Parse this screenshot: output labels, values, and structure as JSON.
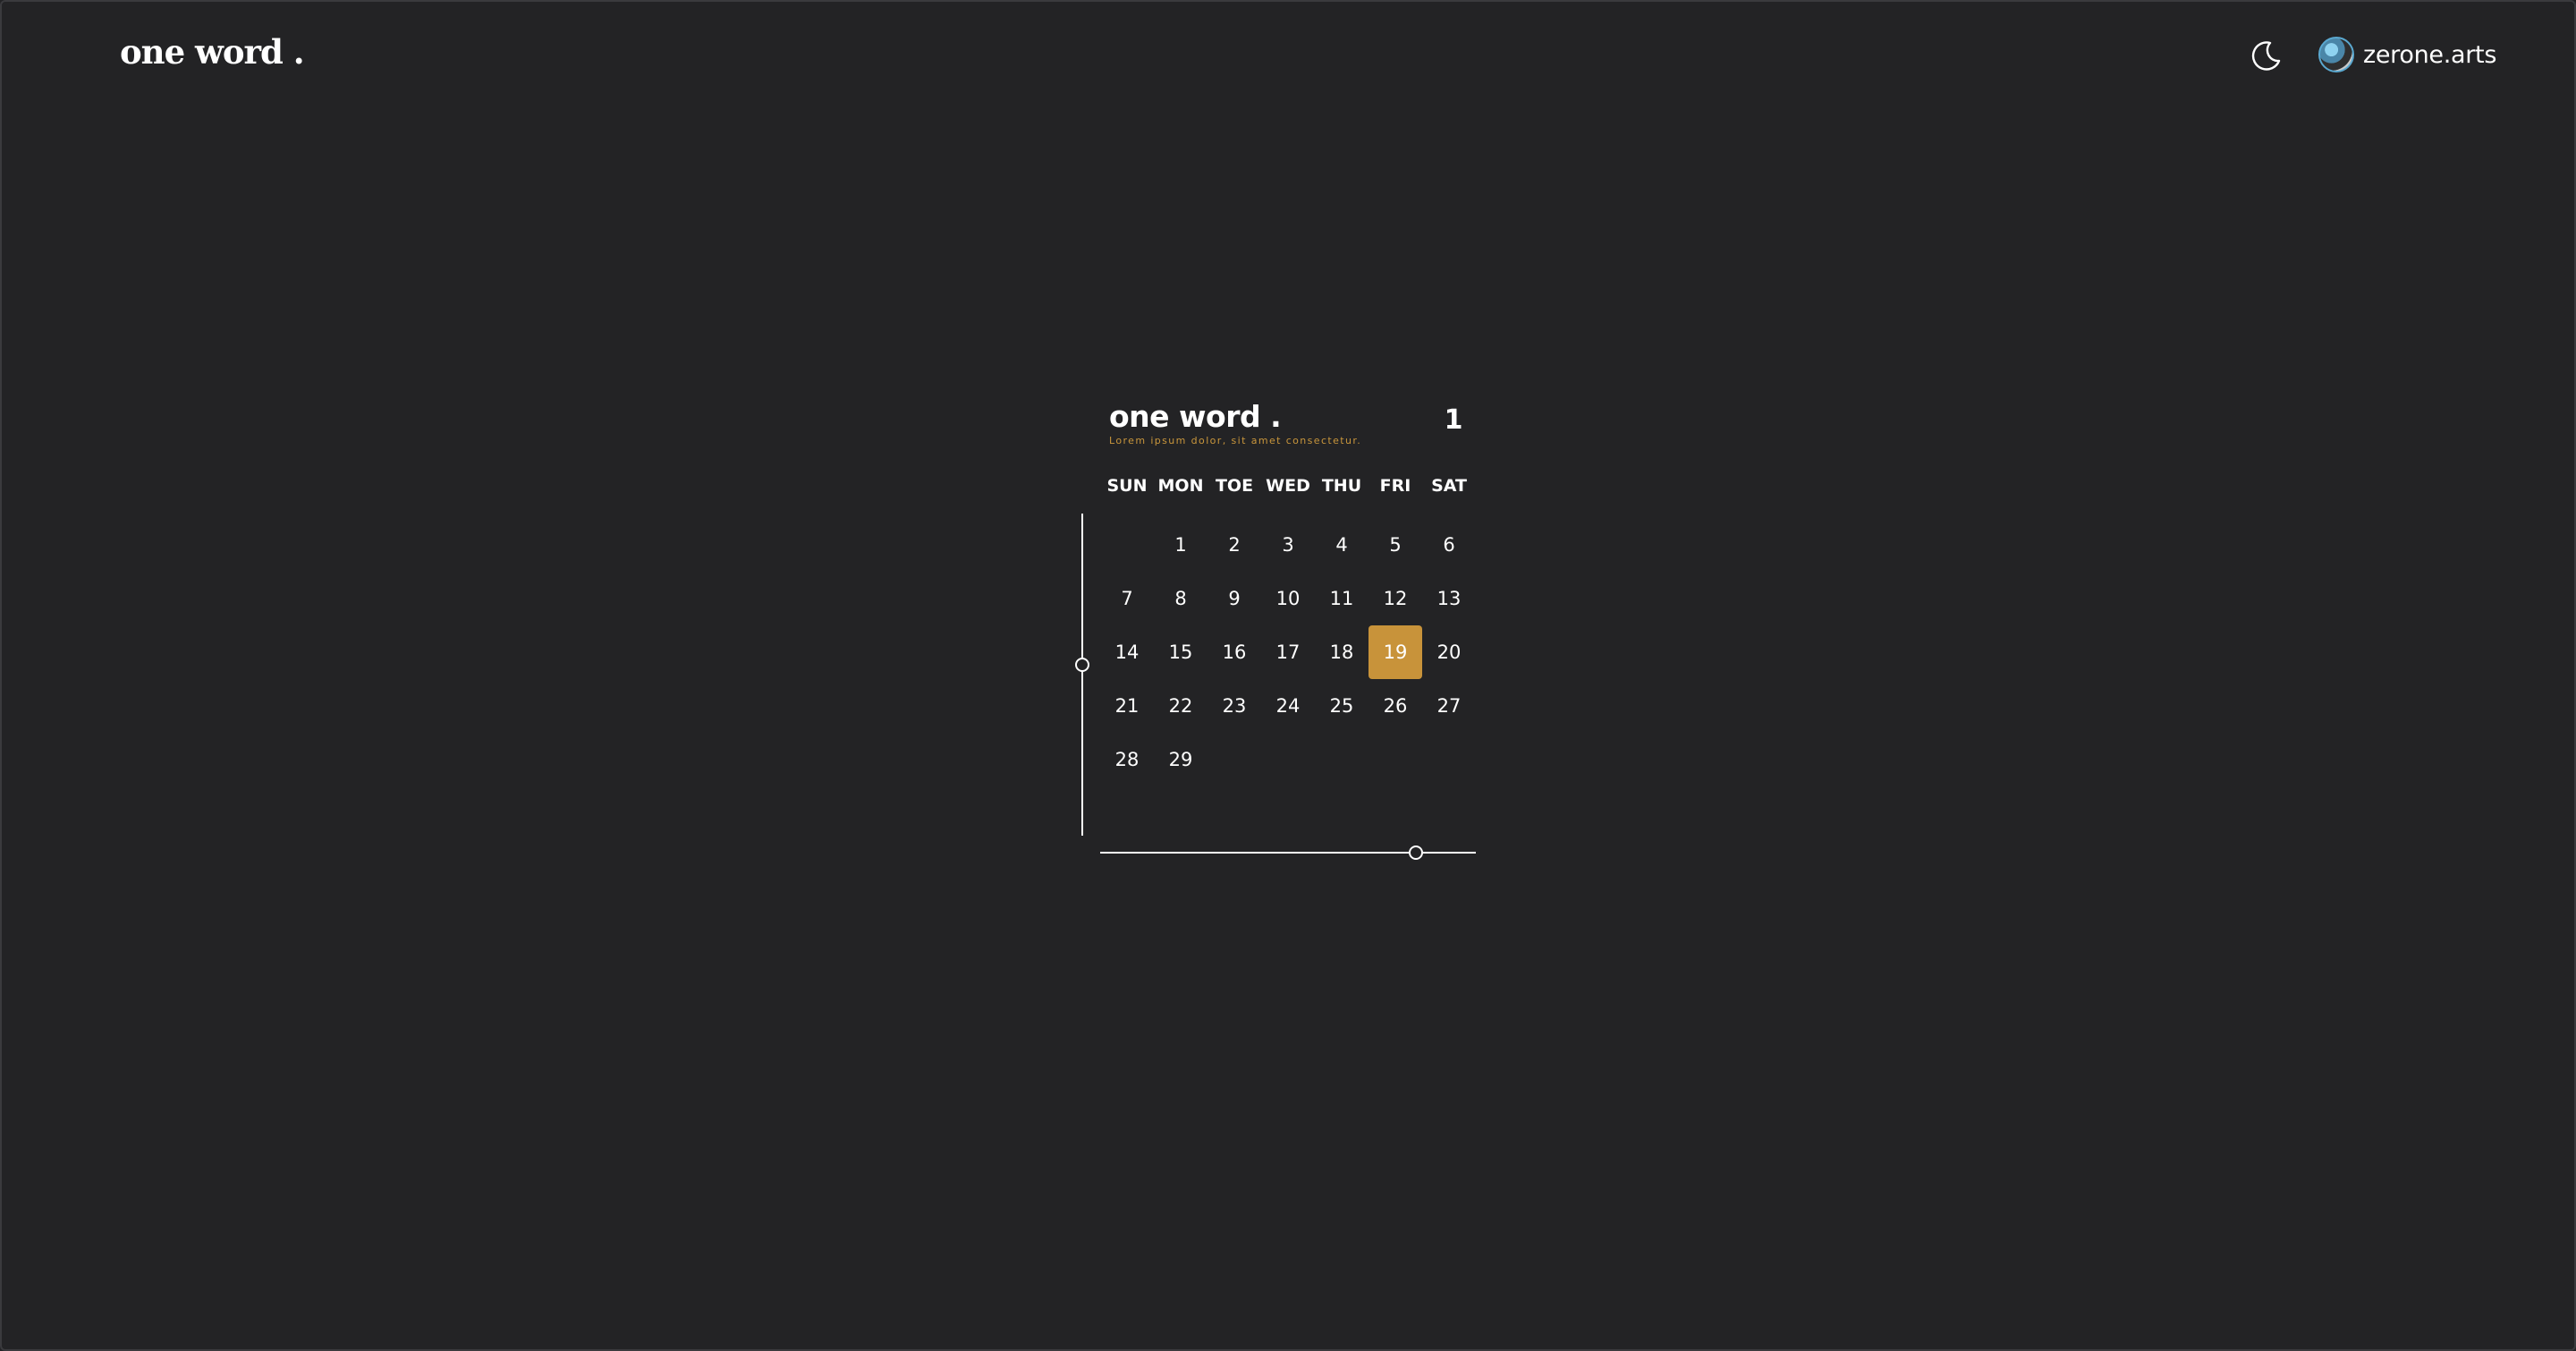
{
  "header": {
    "brand": "one word .",
    "theme_icon": "moon-icon",
    "user_name": "zerone.arts"
  },
  "calendar": {
    "title": "one word .",
    "subtitle": "Lorem ipsum dolor, sit amet consectetur.",
    "month_number": "1",
    "weekdays": [
      "SUN",
      "MON",
      "TOE",
      "WED",
      "THU",
      "FRI",
      "SAT"
    ],
    "weeks": [
      [
        "",
        "1",
        "2",
        "3",
        "4",
        "5",
        "6"
      ],
      [
        "7",
        "8",
        "9",
        "10",
        "11",
        "12",
        "13"
      ],
      [
        "14",
        "15",
        "16",
        "17",
        "18",
        "19",
        "20"
      ],
      [
        "21",
        "22",
        "23",
        "24",
        "25",
        "26",
        "27"
      ],
      [
        "28",
        "29",
        "",
        "",
        "",
        "",
        ""
      ]
    ],
    "selected_day": "19",
    "accent_color": "#c8933a",
    "vertical_slider_value": 0.47,
    "horizontal_slider_value": 0.84
  }
}
